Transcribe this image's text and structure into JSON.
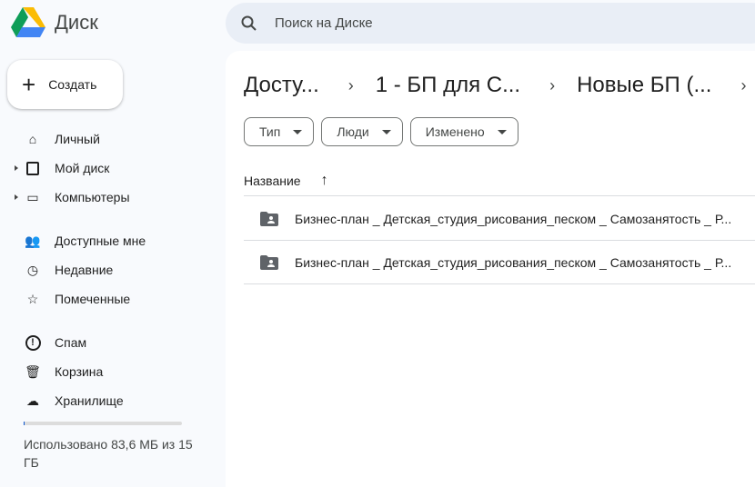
{
  "app": {
    "title": "Диск"
  },
  "search": {
    "placeholder": "Поиск на Диске"
  },
  "create_label": "Создать",
  "nav": [
    {
      "label": "Личный",
      "icon": "home-icon"
    },
    {
      "label": "Мой диск",
      "icon": "drive-icon"
    },
    {
      "label": "Компьютеры",
      "icon": "computers-icon"
    },
    {
      "label": "Доступные мне",
      "icon": "shared-icon"
    },
    {
      "label": "Недавние",
      "icon": "clock-icon"
    },
    {
      "label": "Помеченные",
      "icon": "star-icon"
    },
    {
      "label": "Спам",
      "icon": "spam-icon"
    },
    {
      "label": "Корзина",
      "icon": "trash-icon"
    },
    {
      "label": "Хранилище",
      "icon": "cloud-icon"
    }
  ],
  "storage": {
    "text": "Использовано 83,6 МБ из 15 ГБ",
    "used_fraction": 0.0056
  },
  "breadcrumbs": [
    "Досту...",
    "1 - БП для С...",
    "Новые БП (..."
  ],
  "filters": [
    "Тип",
    "Люди",
    "Изменено"
  ],
  "table": {
    "name_header": "Название",
    "rows": [
      "Бизнес-план _ Детская_студия_рисования_песком  _ Самозанятость _ Р...",
      "Бизнес-план _ Детская_студия_рисования_песком  _ Самозанятость _ Р..."
    ]
  }
}
